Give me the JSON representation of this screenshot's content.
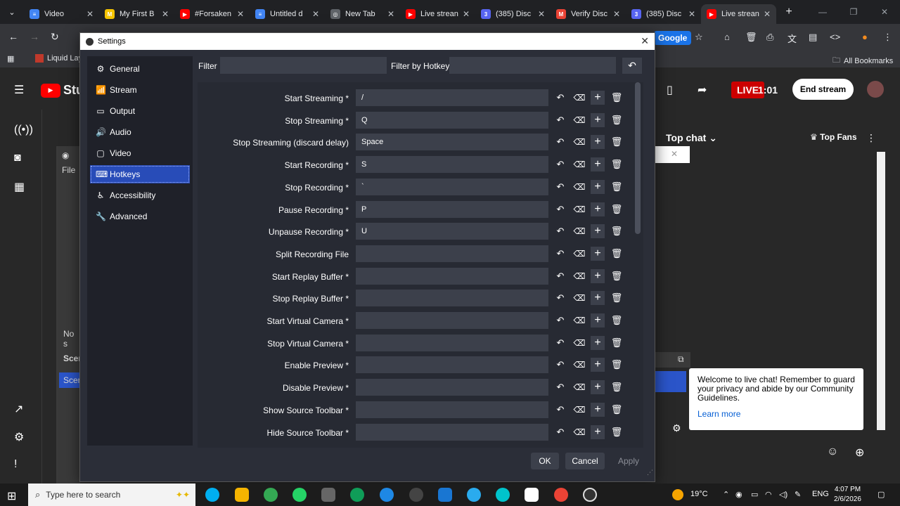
{
  "browser": {
    "tabs": [
      {
        "title": "Video",
        "color": "#4285f4",
        "glyph": "≡"
      },
      {
        "title": "My First B",
        "color": "#f5c400",
        "glyph": "M"
      },
      {
        "title": "#Forsaken",
        "color": "#ff0000",
        "glyph": "▶"
      },
      {
        "title": "Untitled d",
        "color": "#4285f4",
        "glyph": "≡"
      },
      {
        "title": "New Tab",
        "color": "#5f6368",
        "glyph": "◎"
      },
      {
        "title": "Live strean",
        "color": "#ff0000",
        "glyph": "▶"
      },
      {
        "title": "(385) Disc",
        "color": "#5865f2",
        "glyph": "3"
      },
      {
        "title": "Verify Disc",
        "color": "#ea4335",
        "glyph": "M"
      },
      {
        "title": "(385) Disc",
        "color": "#5865f2",
        "glyph": "3"
      },
      {
        "title": "Live strean",
        "color": "#ff0000",
        "glyph": "▶"
      }
    ],
    "google_chip": "Google",
    "bookmarks": {
      "liquid": "Liquid Laye",
      "all": "All Bookmarks"
    }
  },
  "youtube": {
    "logo_text": "Stu",
    "live": "LIVE",
    "live_time": "1:01",
    "end_stream": "End stream",
    "top_chat": "Top chat",
    "top_fans": "Top Fans",
    "chat_welcome": "Welcome to live chat! Remember to guard your privacy and abide by our Community Guidelines.",
    "learn_more": "Learn more",
    "obs_file": "File",
    "obs_no": "No s",
    "obs_scene1": "Scer",
    "obs_scene2": "Scer"
  },
  "dialog": {
    "title": "Settings",
    "sidebar": [
      {
        "label": "General",
        "icon": "⚙"
      },
      {
        "label": "Stream",
        "icon": "📶"
      },
      {
        "label": "Output",
        "icon": "▭"
      },
      {
        "label": "Audio",
        "icon": "🔊"
      },
      {
        "label": "Video",
        "icon": "▢"
      },
      {
        "label": "Hotkeys",
        "icon": "⌨"
      },
      {
        "label": "Accessibility",
        "icon": "♿"
      },
      {
        "label": "Advanced",
        "icon": "🔧"
      }
    ],
    "filter_label": "Filter",
    "filter_hotkey_label": "Filter by Hotkey",
    "hotkeys": [
      {
        "label": "Start Streaming *",
        "key": "/"
      },
      {
        "label": "Stop Streaming *",
        "key": "Q"
      },
      {
        "label": "Stop Streaming (discard delay)",
        "key": "Space"
      },
      {
        "label": "Start Recording *",
        "key": "S"
      },
      {
        "label": "Stop Recording *",
        "key": "`"
      },
      {
        "label": "Pause Recording *",
        "key": "P"
      },
      {
        "label": "Unpause Recording *",
        "key": "U"
      },
      {
        "label": "Split Recording File",
        "key": ""
      },
      {
        "label": "Start Replay Buffer *",
        "key": ""
      },
      {
        "label": "Stop Replay Buffer *",
        "key": ""
      },
      {
        "label": "Start Virtual Camera *",
        "key": ""
      },
      {
        "label": "Stop Virtual Camera *",
        "key": ""
      },
      {
        "label": "Enable Preview *",
        "key": ""
      },
      {
        "label": "Disable Preview *",
        "key": ""
      },
      {
        "label": "Show Source Toolbar *",
        "key": ""
      },
      {
        "label": "Hide Source Toolbar *",
        "key": ""
      }
    ],
    "ok": "OK",
    "cancel": "Cancel",
    "apply": "Apply"
  },
  "taskbar": {
    "search_placeholder": "Type here to search",
    "weather": "19°C",
    "lang": "ENG",
    "time": "4:07 PM",
    "date": "2/6/2026"
  }
}
